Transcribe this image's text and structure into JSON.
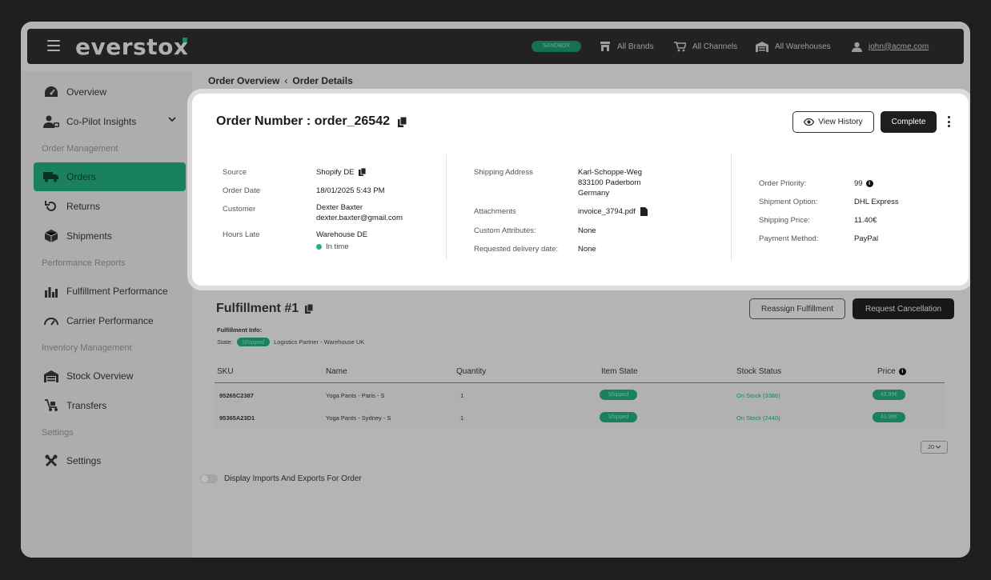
{
  "topbar": {
    "logo": "everstox",
    "env_label": "SANDBOX",
    "brands": "All Brands",
    "channels": "All Channels",
    "warehouses": "All Warehouses",
    "user": "john@acme.com"
  },
  "sidebar": {
    "items": [
      {
        "label": "Overview",
        "icon": "gauge-icon"
      },
      {
        "label": "Co-Pilot Insights",
        "icon": "copilot-icon"
      },
      {
        "label": "Orders",
        "icon": "truck-icon"
      },
      {
        "label": "Returns",
        "icon": "return-icon"
      },
      {
        "label": "Shipments",
        "icon": "box-icon"
      },
      {
        "label": "Fulfillment Performance",
        "icon": "bar-chart-icon"
      },
      {
        "label": "Carrier Performance",
        "icon": "speedometer-icon"
      },
      {
        "label": "Stock Overview",
        "icon": "warehouse-icon"
      },
      {
        "label": "Transfers",
        "icon": "transfer-icon"
      },
      {
        "label": "Settings",
        "icon": "tools-icon"
      }
    ],
    "sections": {
      "order_management": "Order Management",
      "performance_reports": "Performance Reports",
      "inventory_management": "Inventory Management",
      "settings": "Settings"
    }
  },
  "breadcrumb": {
    "parent": "Order Overview",
    "current": "Order Details"
  },
  "order": {
    "title_label": "Order Number :",
    "number": "order_26542",
    "view_history": "View History",
    "complete": "Complete",
    "source_label": "Source",
    "source": "Shopify DE",
    "order_date_label": "Order Date",
    "order_date": "18/01/2025 5:43 PM",
    "customer_label": "Customer",
    "customer_name": "Dexter Baxter",
    "customer_email": "dexter.baxter@gmail.com",
    "hours_late_label": "Hours Late",
    "warehouse": "Warehouse DE",
    "timing": "In time",
    "shipping_address_label": "Shipping Address",
    "address_line1": "Karl-Schoppe-Weg",
    "address_line2": "833100 Paderborn",
    "address_line3": "Germany",
    "attachments_label": "Attachments",
    "attachment": "invoice_3794.pdf",
    "custom_attributes_label": "Custom Attributes:",
    "custom_attributes": "None",
    "requested_delivery_label": "Requested delivery date:",
    "requested_delivery": "None",
    "priority_label": "Order Priority:",
    "priority": "99",
    "shipment_option_label": "Shipment Option:",
    "shipment_option": "DHL Express",
    "shipping_price_label": "Shipping Price:",
    "shipping_price": "11.40€",
    "payment_method_label": "Payment Method:",
    "payment_method": "PayPal"
  },
  "fulfillment": {
    "title": "Fulfillment #1",
    "reassign": "Reassign Fulfillment",
    "request_cancel": "Request Cancellation",
    "info_label": "Fulfillment Info:",
    "state_label": "State:",
    "state": "Shipped",
    "partner": "Logistics Partner - Warehouse UK",
    "columns": [
      "SKU",
      "Name",
      "Quantity",
      "Item State",
      "Stock Status",
      "Price"
    ],
    "rows": [
      {
        "sku": "95265C2387",
        "name": "Yoga Pants - Paris - S",
        "qty": "1",
        "state": "Shipped",
        "stock": "On Stock (3386)",
        "price": "43.99€"
      },
      {
        "sku": "95365A23D1",
        "name": "Yoga Pants - Sydney - S",
        "qty": "1",
        "state": "Shipped",
        "stock": "On Stock (2440)",
        "price": "43.99€"
      }
    ],
    "page_size": "20"
  },
  "toggle": {
    "label": "Display Imports And Exports For Order"
  }
}
